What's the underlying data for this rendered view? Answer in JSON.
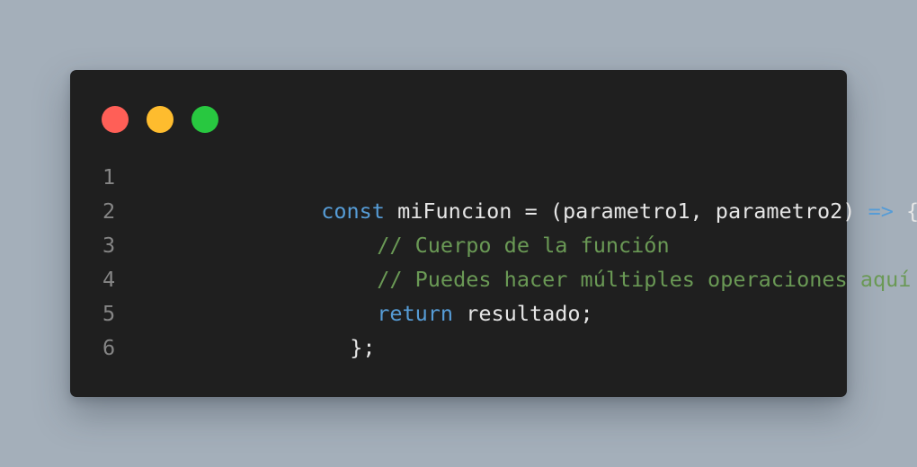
{
  "colors": {
    "background": "#a4afba",
    "window": "#1f1f1f",
    "dot_red": "#ff5f57",
    "dot_yellow": "#febc2e",
    "dot_green": "#28c840",
    "keyword": "#569cd6",
    "comment": "#6a9955",
    "plain": "#e6e6e6",
    "line_number": "#858585"
  },
  "window": {
    "controls": [
      {
        "name": "close",
        "color": "#ff5f57"
      },
      {
        "name": "minimize",
        "color": "#febc2e"
      },
      {
        "name": "maximize",
        "color": "#28c840"
      }
    ]
  },
  "code": {
    "line_numbers": [
      "1",
      "2",
      "3",
      "4",
      "5",
      "6"
    ],
    "lines": [
      {
        "tokens": [
          {
            "type": "keyword",
            "text": "const"
          },
          {
            "type": "plain",
            "text": " miFuncion = (parametro1, parametro2) "
          },
          {
            "type": "keyword",
            "text": "=>"
          },
          {
            "type": "plain",
            "text": " {"
          }
        ]
      },
      {
        "tokens": [
          {
            "type": "comment",
            "text": "// Cuerpo de la función"
          }
        ]
      },
      {
        "tokens": [
          {
            "type": "comment",
            "text": "// Puedes hacer múltiples operaciones aquí"
          }
        ]
      },
      {
        "tokens": [
          {
            "type": "keyword",
            "text": "return"
          },
          {
            "type": "plain",
            "text": " resultado;"
          }
        ]
      },
      {
        "tokens": [
          {
            "type": "plain",
            "text": "};"
          }
        ]
      },
      {
        "tokens": []
      }
    ]
  }
}
